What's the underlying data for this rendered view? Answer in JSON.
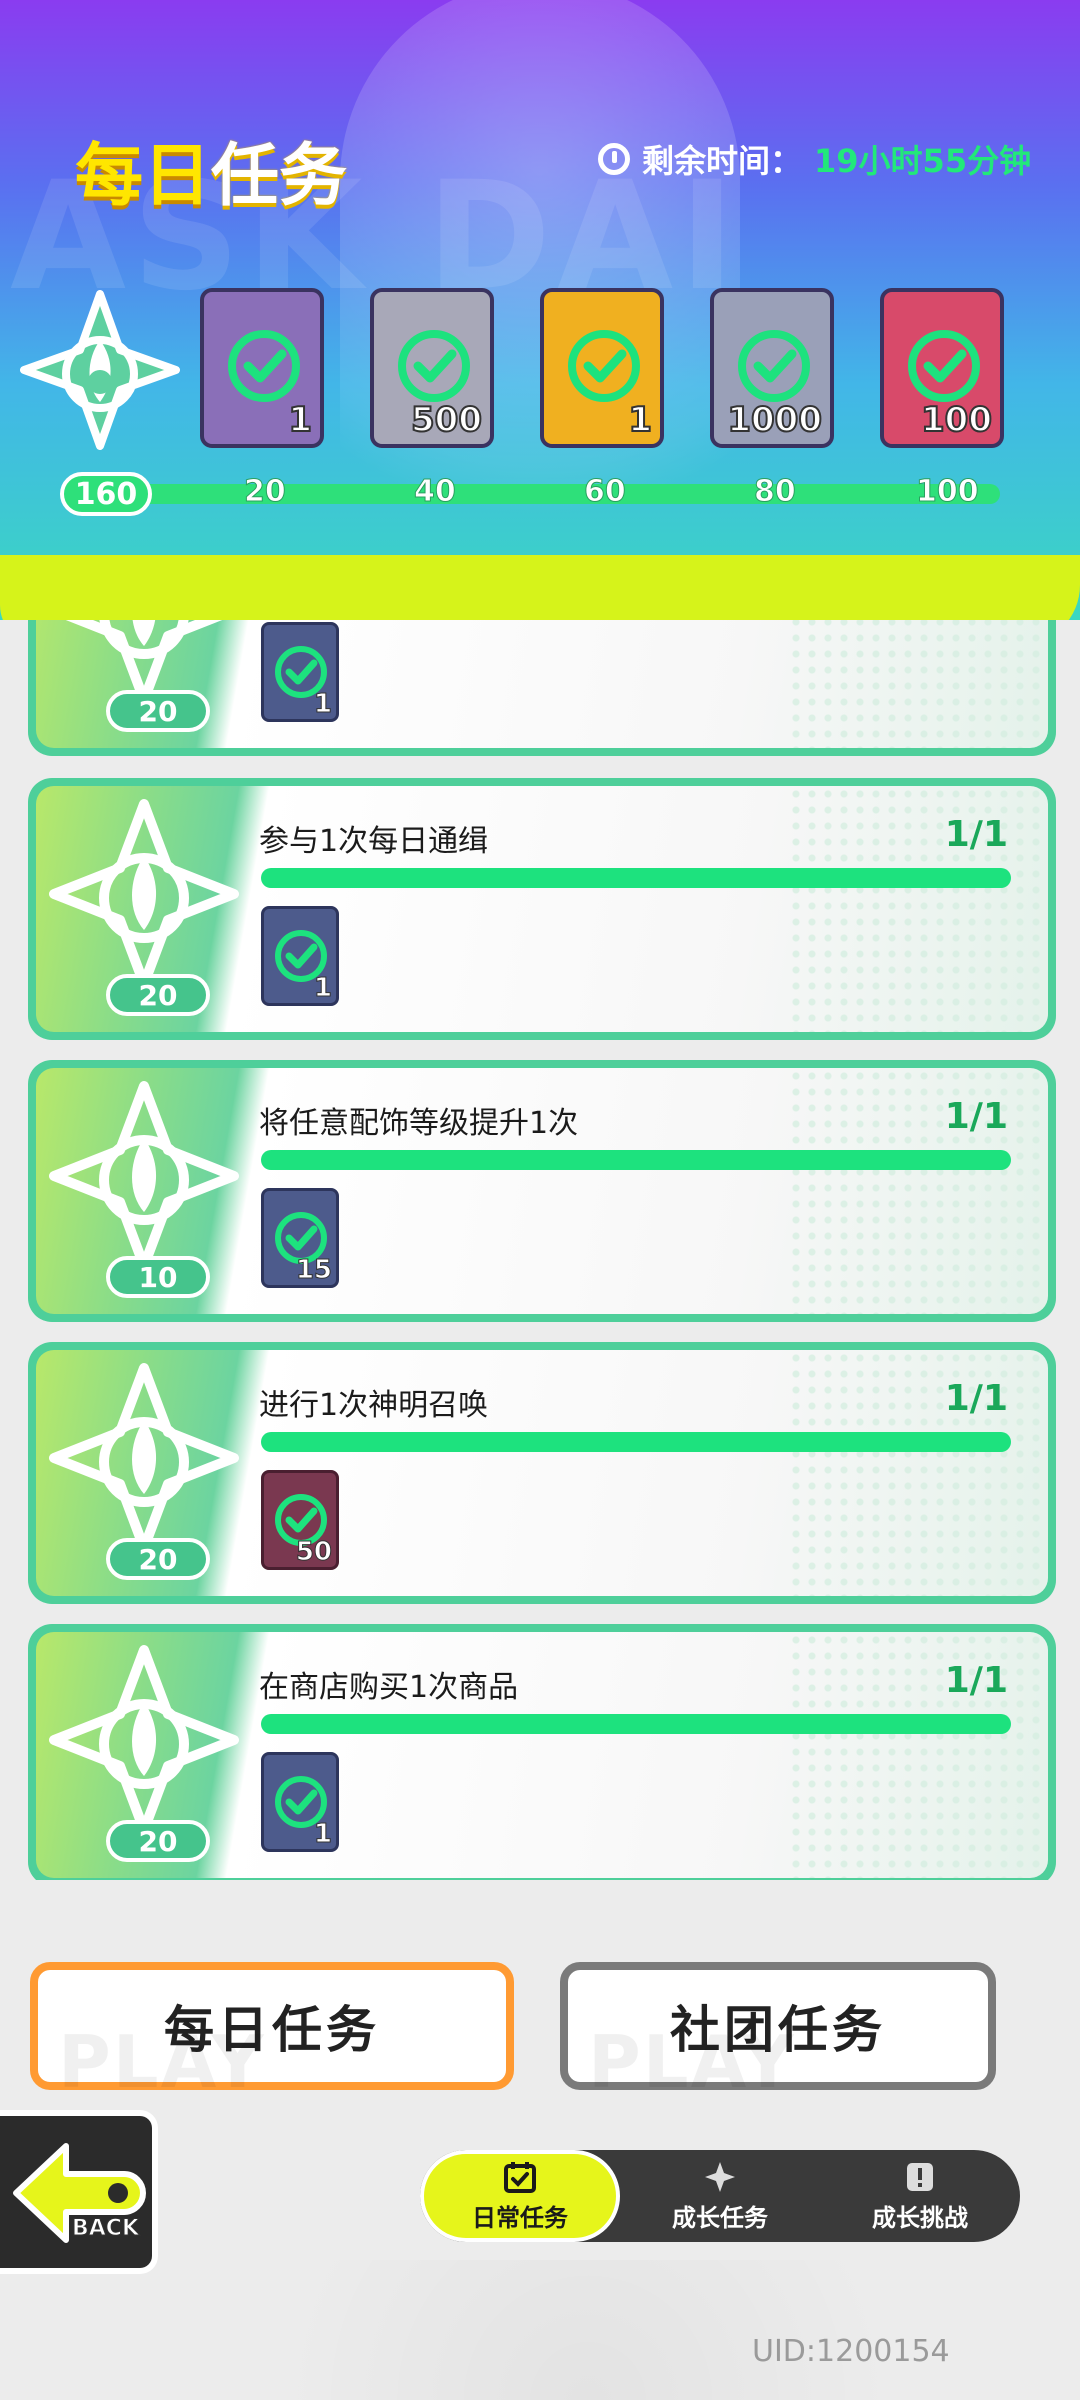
{
  "header": {
    "title_part1": "每日",
    "title_part2": "任务",
    "timer_label": "剩余时间：",
    "timer_value": "19小时55分钟",
    "watermark": "ASK DAI"
  },
  "rewards": [
    {
      "qty": "1",
      "color": "#8a6fb8",
      "claimed": true
    },
    {
      "qty": "500",
      "color": "#a8a8b8",
      "claimed": true
    },
    {
      "qty": "1",
      "color": "#f0b020",
      "claimed": true
    },
    {
      "qty": "1000",
      "color": "#9aa0b8",
      "claimed": true
    },
    {
      "qty": "100",
      "color": "#d84a6a",
      "claimed": true
    }
  ],
  "progress": {
    "current": "160",
    "milestones": [
      "20",
      "40",
      "60",
      "80",
      "100"
    ]
  },
  "tasks": [
    {
      "name": "",
      "count": "",
      "points": "20",
      "item_qty": "1",
      "item_color": "#4a5fa0"
    },
    {
      "name": "参与1次每日通缉",
      "count": "1/1",
      "points": "20",
      "item_qty": "1",
      "item_color": "#4a5fa0"
    },
    {
      "name": "将任意配饰等级提升1次",
      "count": "1/1",
      "points": "10",
      "item_qty": "15",
      "item_color": "#4a5fa0"
    },
    {
      "name": "进行1次神明召唤",
      "count": "1/1",
      "points": "20",
      "item_qty": "50",
      "item_color": "#7a3850"
    },
    {
      "name": "在商店购买1次商品",
      "count": "1/1",
      "points": "20",
      "item_qty": "1",
      "item_color": "#4a5fa0"
    }
  ],
  "bottom_buttons": {
    "daily": "每日任务",
    "club": "社团任务",
    "watermark": "PLAY"
  },
  "back_label": "BACK",
  "tabs": [
    {
      "label": "日常任务",
      "active": true
    },
    {
      "label": "成长任务",
      "active": false
    },
    {
      "label": "成长挑战",
      "active": false
    }
  ],
  "uid": "UID:1200154",
  "colors": {
    "accent_green": "#1de27e",
    "slime_yellow": "#d6f31a",
    "daily_border": "#ff9a32"
  }
}
